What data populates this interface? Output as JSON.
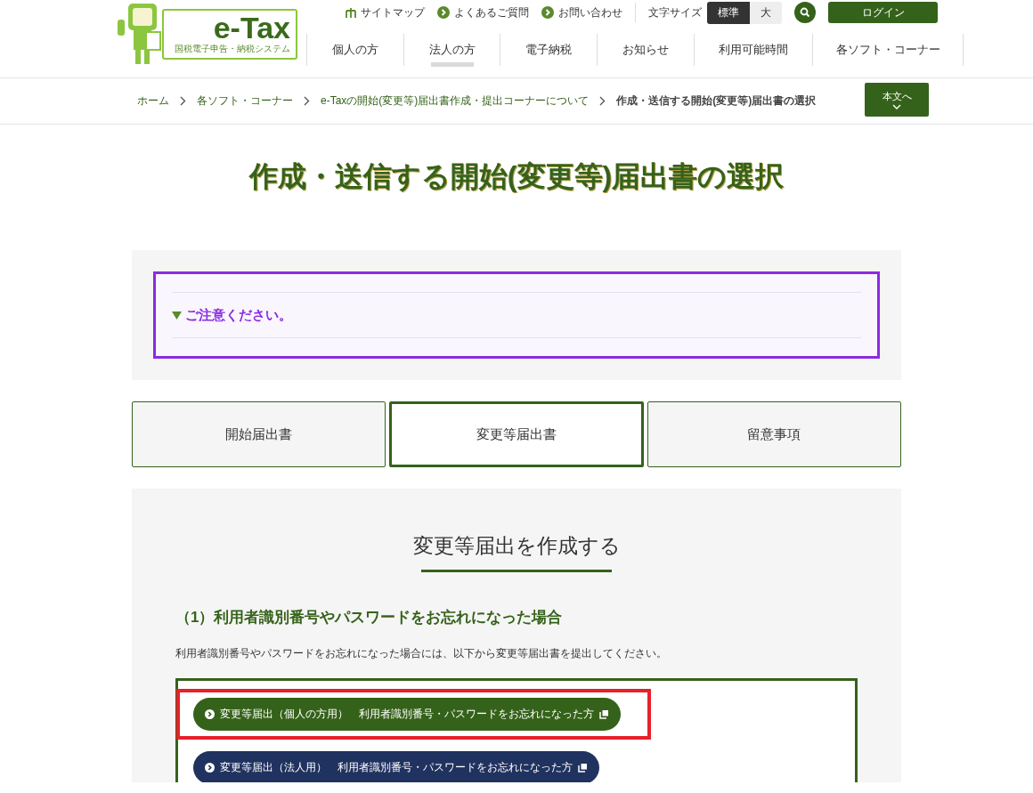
{
  "logo": {
    "name": "e-Tax",
    "tagline": "国税電子申告・納税システム"
  },
  "utility_links": [
    {
      "label": "サイトマップ",
      "kind": "sitemap"
    },
    {
      "label": "よくあるご質問",
      "kind": "link"
    },
    {
      "label": "お問い合わせ",
      "kind": "link"
    }
  ],
  "font_size": {
    "label": "文字サイズ",
    "options": [
      {
        "label": "標準",
        "selected": true
      },
      {
        "label": "大",
        "selected": false
      }
    ]
  },
  "login": "ログイン",
  "nav": [
    {
      "label": "個人の方",
      "selected": false
    },
    {
      "label": "法人の方",
      "selected": true
    },
    {
      "label": "電子納税",
      "selected": false
    },
    {
      "label": "お知らせ",
      "selected": false
    },
    {
      "label": "利用可能時間",
      "selected": false
    },
    {
      "label": "各ソフト・コーナー",
      "selected": false
    }
  ],
  "breadcrumb": [
    {
      "label": "ホーム",
      "current": false
    },
    {
      "label": "各ソフト・コーナー",
      "current": false
    },
    {
      "label": "e-Taxの開始(変更等)届出書作成・提出コーナーについて",
      "current": false
    },
    {
      "label": "作成・送信する開始(変更等)届出書の選択",
      "current": true
    }
  ],
  "skip_button": "本文へ",
  "title": "作成・送信する開始(変更等)届出書の選択",
  "notice": {
    "label": "ご注意ください。",
    "expanded": true
  },
  "tabs": [
    {
      "label": "開始届出書",
      "selected": false
    },
    {
      "label": "変更等届出書",
      "selected": true
    },
    {
      "label": "留意事項",
      "selected": false
    }
  ],
  "section": {
    "heading": "変更等届出を作成する",
    "subheading": "（1）利用者識別番号やパスワードをお忘れになった場合",
    "text": "利用者識別番号やパスワードをお忘れになった場合には、以下から変更等届出書を提出してください。",
    "links": [
      {
        "label": "変更等届出（個人の方用）　利用者識別番号・パスワードをお忘れになった方",
        "color": "#35621a",
        "highlighted": true
      },
      {
        "label": "変更等届出（法人用）　利用者識別番号・パスワードをお忘れになった方",
        "color": "#20325f",
        "highlighted": false
      }
    ]
  }
}
